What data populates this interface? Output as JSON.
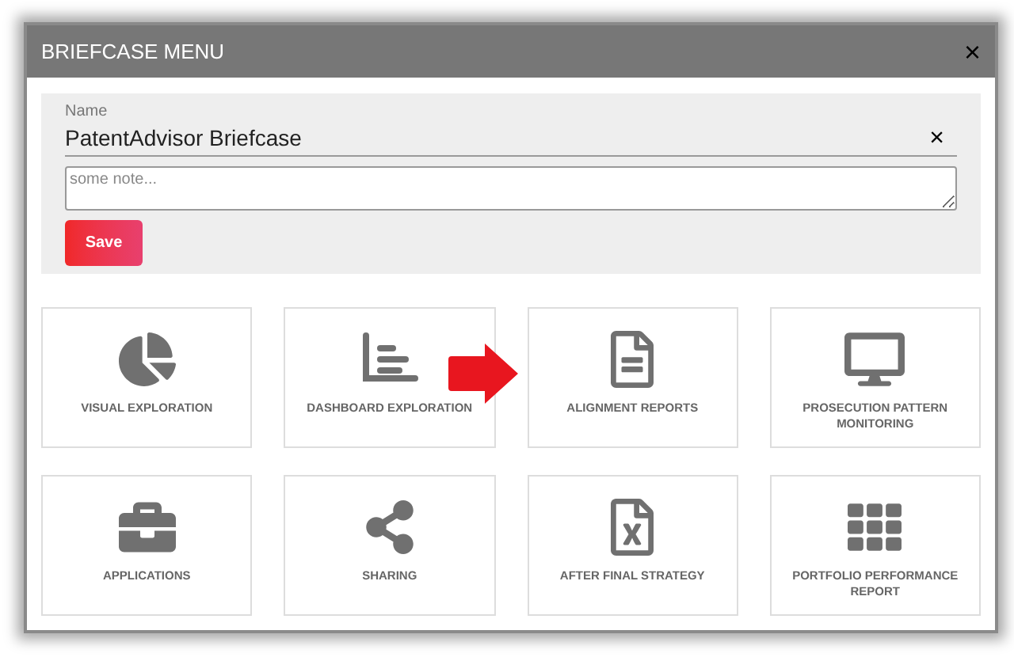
{
  "window": {
    "title": "BRIEFCASE MENU",
    "close": "×"
  },
  "form": {
    "name_label": "Name",
    "name_value": "PatentAdvisor Briefcase",
    "clear": "×",
    "note_placeholder": "some note...",
    "save": "Save"
  },
  "tiles": [
    {
      "label": "VISUAL EXPLORATION"
    },
    {
      "label": "DASHBOARD EXPLORATION"
    },
    {
      "label": "ALIGNMENT REPORTS"
    },
    {
      "label": "PROSECUTION PATTERN MONITORING"
    },
    {
      "label": "APPLICATIONS"
    },
    {
      "label": "SHARING"
    },
    {
      "label": "AFTER FINAL STRATEGY"
    },
    {
      "label": "PORTFOLIO PERFORMANCE REPORT"
    }
  ]
}
